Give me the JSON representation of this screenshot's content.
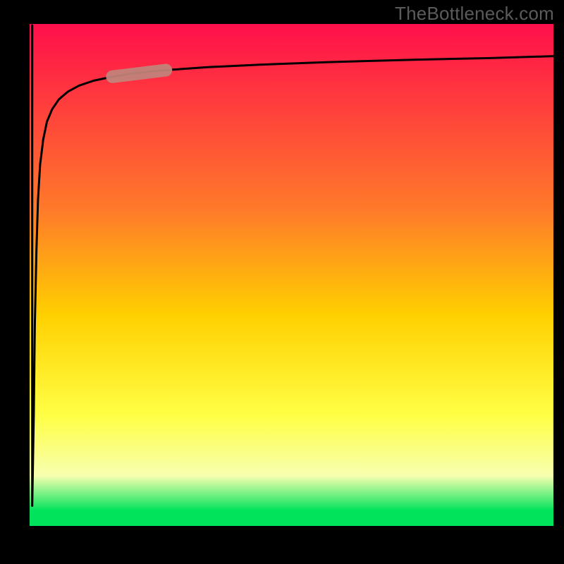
{
  "watermark": "TheBottleneck.com",
  "colors": {
    "frame": "#000000",
    "curve": "#000000",
    "highlight_fill": "#c6887e",
    "highlight_stroke": "#b87b72",
    "grad_top": "#ff0f4b",
    "grad_mid1": "#ff7a2a",
    "grad_mid2": "#ffd000",
    "grad_mid3": "#ffff45",
    "grad_band": "#f7ffb0",
    "grad_bottom": "#00e35a"
  },
  "chart_data": {
    "type": "line",
    "title": "",
    "xlabel": "",
    "ylabel": "",
    "xlim": [
      0,
      100
    ],
    "ylim": [
      0,
      100
    ],
    "series": [
      {
        "name": "bottleneck-curve",
        "x": [
          0.5,
          0.8,
          1.0,
          1.3,
          1.6,
          2.0,
          2.6,
          3.3,
          4.3,
          5.6,
          7.3,
          9.4,
          12.2,
          15.8,
          20.0,
          26.0,
          34.0,
          44.0,
          57.0,
          74.0,
          88.0,
          100.0
        ],
        "y": [
          4.0,
          22.0,
          40.0,
          55.0,
          65.0,
          72.0,
          77.0,
          80.5,
          83.0,
          85.0,
          86.5,
          87.7,
          88.7,
          89.5,
          90.2,
          90.8,
          91.4,
          91.9,
          92.4,
          92.9,
          93.2,
          93.6
        ]
      }
    ],
    "highlight_segment": {
      "x_start": 15.8,
      "x_end": 26.0
    },
    "background_gradient_stops": [
      {
        "pos": 0.0,
        "color": "#ff0f4b"
      },
      {
        "pos": 0.37,
        "color": "#ff7a2a"
      },
      {
        "pos": 0.58,
        "color": "#ffd000"
      },
      {
        "pos": 0.78,
        "color": "#ffff45"
      },
      {
        "pos": 0.9,
        "color": "#f7ffb0"
      },
      {
        "pos": 0.97,
        "color": "#00e35a"
      },
      {
        "pos": 1.0,
        "color": "#00e35a"
      }
    ]
  }
}
